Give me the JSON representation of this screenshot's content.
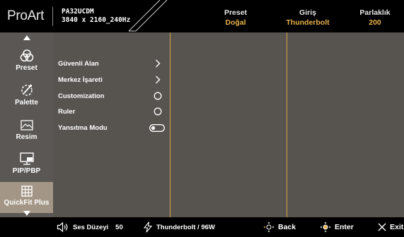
{
  "header": {
    "logo": "ProArt",
    "model_line1": "PA32UCDM",
    "model_line2": "3840 x 2160_240Hz",
    "stats": [
      {
        "label": "Preset",
        "value": "Doğal"
      },
      {
        "label": "Giriş",
        "value": "Thunderbolt"
      },
      {
        "label": "Parlaklık",
        "value": "200"
      }
    ]
  },
  "sidebar": {
    "items": [
      {
        "label": "Preset",
        "icon": "preset-icon"
      },
      {
        "label": "Palette",
        "icon": "palette-icon"
      },
      {
        "label": "Resim",
        "icon": "image-icon"
      },
      {
        "label": "PIP/PBP",
        "icon": "pip-icon"
      },
      {
        "label": "QuickFit Plus",
        "icon": "grid-icon",
        "active": true
      }
    ]
  },
  "menu": {
    "items": [
      {
        "label": "Güvenli Alan",
        "control": "chevron-right-icon"
      },
      {
        "label": "Merkez İşareti",
        "control": "chevron-right-icon"
      },
      {
        "label": "Customization",
        "control": "radio-icon"
      },
      {
        "label": "Ruler",
        "control": "radio-icon"
      },
      {
        "label": "Yansıtma Modu",
        "control": "toggle-icon",
        "toggle_on": false
      }
    ]
  },
  "footer": {
    "volume_label": "Ses Düzeyi",
    "volume_value": "50",
    "source": "Thunderbolt / 96W",
    "back": "Back",
    "enter": "Enter",
    "exit": "Exit"
  },
  "colors": {
    "accent": "#e8b04a",
    "panel_bg": "#575450",
    "sidebar_bg": "#5a5754",
    "active_bg": "#a39686",
    "divider": "#d8a24a"
  }
}
